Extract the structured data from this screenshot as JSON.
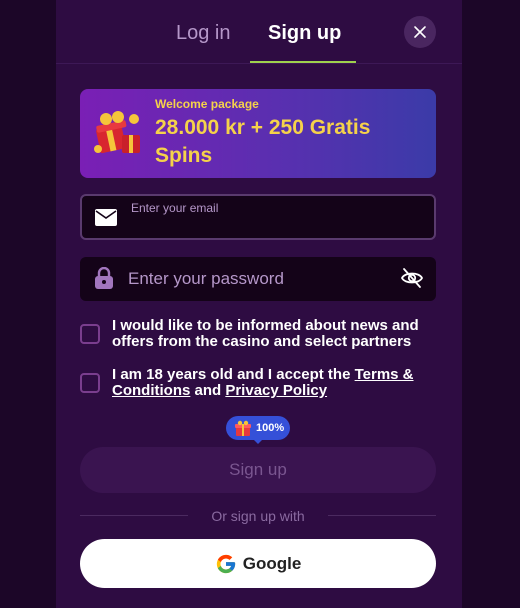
{
  "tabs": {
    "login_label": "Log in",
    "signup_label": "Sign up"
  },
  "banner": {
    "title": "Welcome package",
    "amount": "28.000 kr + 250 Gratis Spins"
  },
  "email": {
    "label": "Enter your email",
    "value": ""
  },
  "password": {
    "placeholder": "Enter your password"
  },
  "consent": {
    "news_text": "I would like to be informed about news and offers from the casino and select partners",
    "age_prefix": "I am 18 years old and I accept the ",
    "terms_link": "Terms & Conditions",
    "and_text": " and ",
    "privacy_link": "Privacy Policy"
  },
  "progress": {
    "label": "100%",
    "value": 1.0
  },
  "signup_button_label": "Sign up",
  "divider_text": "Or sign up with",
  "google_button_label": "Google",
  "colors": {
    "accent_underline": "#9fd14d",
    "banner_gold": "#f5d24a",
    "badge_blue": "#3550d8"
  },
  "icons": {
    "close": "close-icon",
    "email": "envelope-icon",
    "lock": "lock-icon",
    "visibility": "eye-off-icon",
    "gift": "gift-icon",
    "google": "google-icon"
  }
}
